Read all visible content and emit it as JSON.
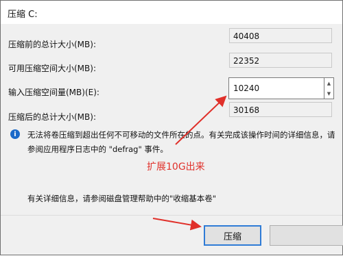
{
  "window": {
    "title": "压缩 C:"
  },
  "rows": [
    {
      "label": "压缩前的总计大小(MB):",
      "value": "40408"
    },
    {
      "label": "可用压缩空间大小(MB):",
      "value": "22352"
    },
    {
      "label": "输入压缩空间量(MB)(E):",
      "value": "10240"
    },
    {
      "label": "压缩后的总计大小(MB):",
      "value": "30168"
    }
  ],
  "info": {
    "icon": "info-icon",
    "text": "无法将卷压缩到超出任何不可移动的文件所在的点。有关完成该操作时间的详细信息，请参阅应用程序日志中的 \"defrag\" 事件。"
  },
  "annotation": {
    "text": "扩展10G出来",
    "color": "#e0302a"
  },
  "help": {
    "text": "有关详细信息，请参阅磁盘管理帮助中的\"收缩基本卷\""
  },
  "buttons": {
    "shrink": "压缩"
  },
  "colors": {
    "accent": "#2e7bd6",
    "annotation": "#e0302a",
    "info_icon": "#1b6ac9"
  }
}
